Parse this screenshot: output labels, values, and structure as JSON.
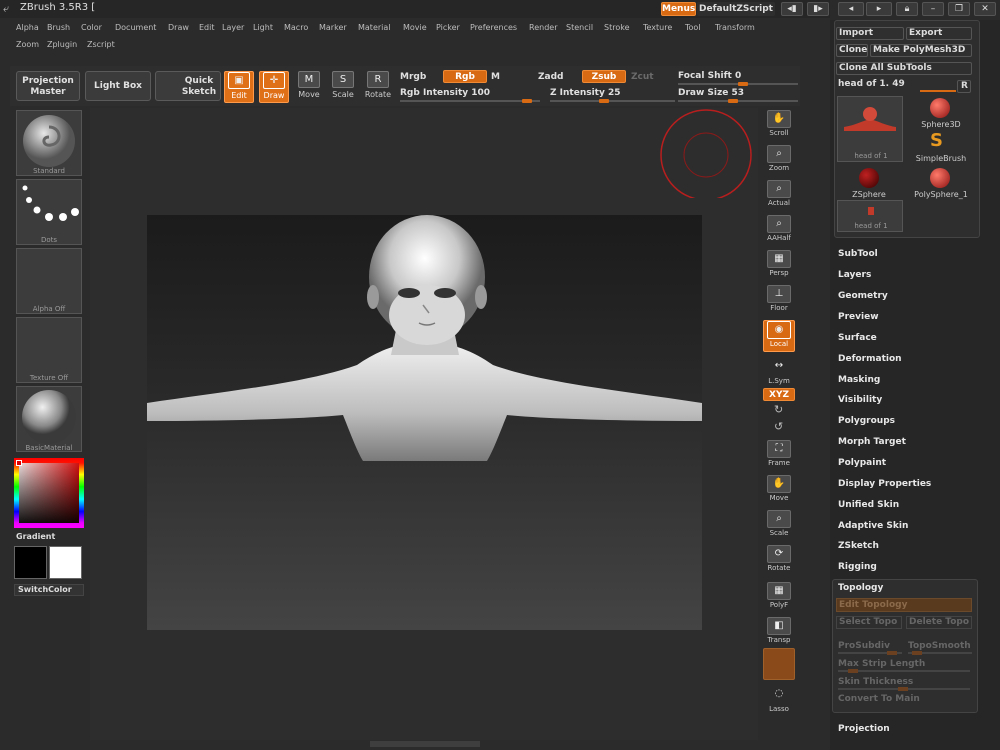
{
  "app": {
    "title": "ZBrush 3.5R3 [",
    "menus_label": "Menus",
    "script_label": "DefaultZScript"
  },
  "menus": {
    "row1": [
      "Alpha",
      "Brush",
      "Color",
      "Document",
      "Draw",
      "Edit",
      "Layer",
      "Light",
      "Macro",
      "Marker",
      "Material",
      "Movie",
      "Picker",
      "Preferences",
      "Render",
      "Stencil",
      "Stroke",
      "Texture",
      "Tool",
      "Transform"
    ],
    "row2": [
      "Zoom",
      "Zplugin",
      "Zscript"
    ]
  },
  "shelf": {
    "projection_master": "Projection Master",
    "light_box": "Light Box",
    "quick_sketch": "Quick Sketch",
    "edit": "Edit",
    "draw": "Draw",
    "move": "Move",
    "scale": "Scale",
    "rotate": "Rotate",
    "mrgb": "Mrgb",
    "rgb": "Rgb",
    "m": "M",
    "zadd": "Zadd",
    "zsub": "Zsub",
    "zcut": "Zcut",
    "rgb_intensity_label": "Rgb Intensity",
    "rgb_intensity": "100",
    "z_intensity_label": "Z Intensity",
    "z_intensity": "25",
    "focal_shift_label": "Focal Shift",
    "focal_shift": "0",
    "draw_size_label": "Draw Size",
    "draw_size": "53"
  },
  "left": {
    "brush": "Standard",
    "stroke": "Dots",
    "alpha": "Alpha Off",
    "texture": "Texture Off",
    "material": "BasicMaterial",
    "gradient": "Gradient",
    "switch_color": "SwitchColor"
  },
  "right": [
    "Scroll",
    "Zoom",
    "Actual",
    "AAHalf",
    "Persp",
    "Floor",
    "Local",
    "L.Sym",
    "XYZ",
    "Frame",
    "Move",
    "Scale",
    "Rotate",
    "PolyF",
    "Transp",
    "Lasso"
  ],
  "tray": {
    "import": "Import",
    "export": "Export",
    "clone": "Clone",
    "make_polymesh": "Make PolyMesh3D",
    "clone_all": "Clone All SubTools",
    "current_tool": "head of 1. 49",
    "r": "R",
    "tools": [
      "Sphere3D",
      "SimpleBrush",
      "ZSphere",
      "PolySphere_1"
    ],
    "tool_thumb1": "head of 1",
    "tool_thumb2": "head of 1",
    "palettes": [
      "SubTool",
      "Layers",
      "Geometry",
      "Preview",
      "Surface",
      "Deformation",
      "Masking",
      "Visibility",
      "Polygroups",
      "Morph Target",
      "Polypaint",
      "Display Properties",
      "Unified Skin",
      "Adaptive Skin",
      "ZSketch",
      "Rigging"
    ],
    "topology": {
      "title": "Topology",
      "edit_topology": "Edit Topology",
      "select_topo": "Select Topo",
      "delete_topo": "Delete Topo",
      "prosubdiv": "ProSubdiv",
      "toposmooth": "TopoSmooth",
      "max_strip": "Max Strip Length",
      "skin_thickness": "Skin Thickness",
      "convert_to_main": "Convert To Main"
    },
    "projection": "Projection"
  },
  "colors": {
    "accent": "#d86a14"
  }
}
